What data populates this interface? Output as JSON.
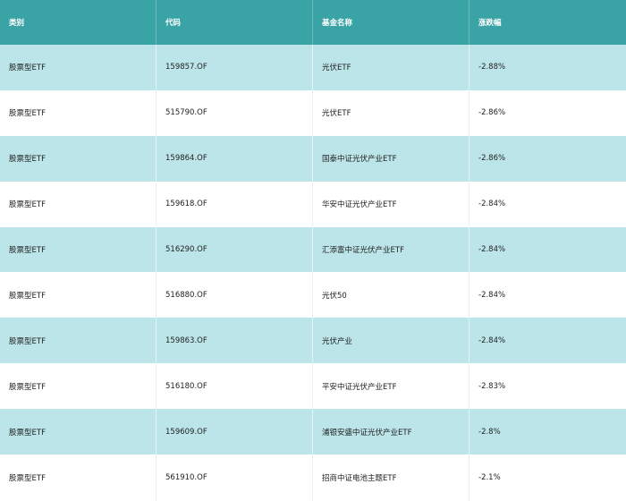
{
  "table": {
    "headers": [
      "类别",
      "代码",
      "基金名称",
      "涨跌幅"
    ],
    "rows": [
      [
        "股票型ETF",
        "159857.OF",
        "光伏ETF",
        "-2.88%"
      ],
      [
        "股票型ETF",
        "515790.OF",
        "光伏ETF",
        "-2.86%"
      ],
      [
        "股票型ETF",
        "159864.OF",
        "国泰中证光伏产业ETF",
        "-2.86%"
      ],
      [
        "股票型ETF",
        "159618.OF",
        "华安中证光伏产业ETF",
        "-2.84%"
      ],
      [
        "股票型ETF",
        "516290.OF",
        "汇添富中证光伏产业ETF",
        "-2.84%"
      ],
      [
        "股票型ETF",
        "516880.OF",
        "光伏50",
        "-2.84%"
      ],
      [
        "股票型ETF",
        "159863.OF",
        "光伏产业",
        "-2.84%"
      ],
      [
        "股票型ETF",
        "516180.OF",
        "平安中证光伏产业ETF",
        "-2.83%"
      ],
      [
        "股票型ETF",
        "159609.OF",
        "浦银安盛中证光伏产业ETF",
        "-2.8%"
      ],
      [
        "股票型ETF",
        "561910.OF",
        "招商中证电池主题ETF",
        "-2.1%"
      ]
    ]
  },
  "colors": {
    "header_bg": "#3aa3a6",
    "row_alt_bg": "#bce5e9",
    "row_bg": "#ffffff"
  }
}
